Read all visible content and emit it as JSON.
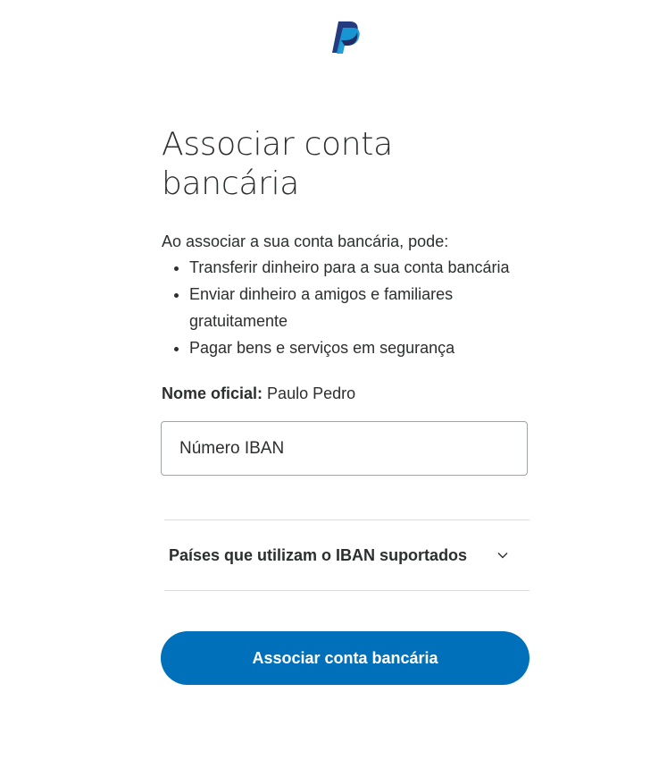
{
  "brand": {
    "logo_icon": "paypal-logo-icon",
    "primary_color": "#0070ba",
    "logo_dark": "#253b80",
    "logo_light": "#179bd7"
  },
  "heading": "Associar conta bancária",
  "intro": "Ao associar a sua conta bancária, pode:",
  "benefits": [
    "Transferir dinheiro para a sua conta bancária",
    "Enviar dinheiro a amigos e familiares gratuitamente",
    "Pagar bens e serviços em segurança"
  ],
  "legal_name": {
    "label": "Nome oficial:",
    "value": "Paulo Pedro"
  },
  "iban": {
    "placeholder": "Número IBAN",
    "value": ""
  },
  "supported_countries": {
    "label": "Países que utilizam o IBAN suportados",
    "icon": "chevron-down-icon",
    "expanded": false
  },
  "submit_label": "Associar conta bancária"
}
